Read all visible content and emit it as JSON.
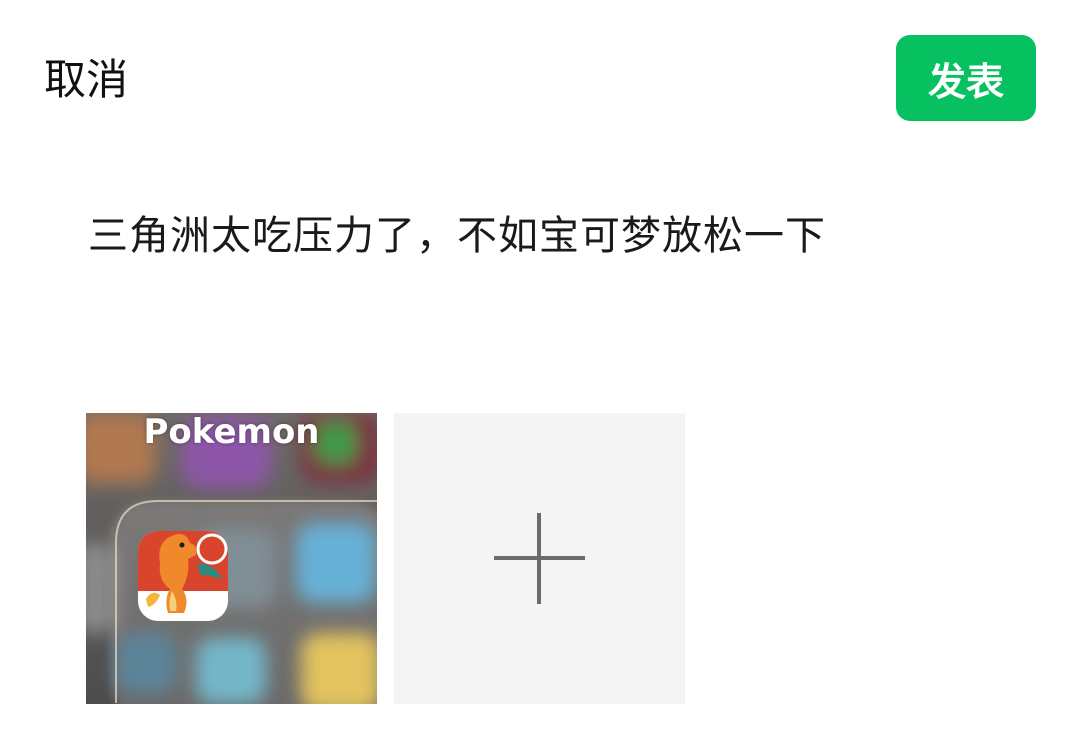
{
  "header": {
    "cancel_label": "取消",
    "publish_label": "发表"
  },
  "post": {
    "text": "三角洲太吃压力了，不如宝可梦放松一下"
  },
  "media": {
    "image_caption": "Pokemon",
    "add_icon": "plus-icon"
  },
  "colors": {
    "accent": "#07c160",
    "add_tile_bg": "#f4f4f4"
  }
}
